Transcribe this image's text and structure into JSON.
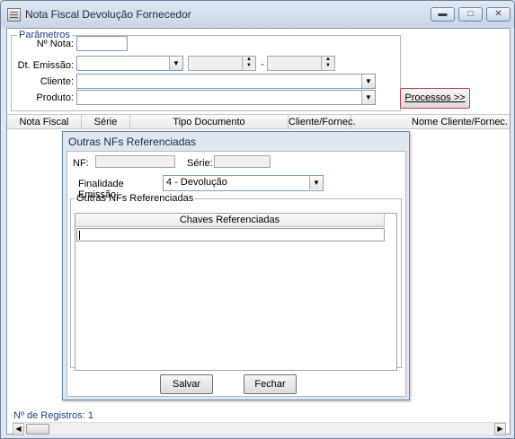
{
  "window": {
    "title": "Nota Fiscal Devolução Fornecedor",
    "minimize_icon": "minimize-icon",
    "maximize_icon": "maximize-icon",
    "close_icon": "close-icon"
  },
  "params": {
    "legend": "Parâmetros",
    "nota_label": "Nº Nota:",
    "nota_value": "",
    "emissao_label": "Dt. Emissão:",
    "emissao_value": "",
    "date_from": "",
    "date_separator": "-",
    "date_to": "",
    "cliente_label": "Cliente:",
    "cliente_value": "",
    "produto_label": "Produto:",
    "produto_value": ""
  },
  "processos_button": "Processos >>",
  "grid": {
    "columns": [
      "Nota Fiscal",
      "Série",
      "Tipo Documento",
      "Cliente/Fornec.",
      "Nome Cliente/Fornec."
    ]
  },
  "records_label": "Nº de Registros: 1",
  "dialog": {
    "title": "Outras NFs Referenciadas",
    "nf_label": "NF:",
    "nf_value": "",
    "serie_label": "Série:",
    "serie_value": "",
    "finalidade_label": "Finalidade Emissão:",
    "finalidade_value": "4 - Devolução",
    "group_legend": "Outras NFs Referenciadas",
    "refs_column": "Chaves Referenciadas",
    "save_button": "Salvar",
    "close_button": "Fechar"
  },
  "colors": {
    "accent_text": "#1a3d8a",
    "window_frame": "#dde6f1",
    "highlight_border": "#c84040"
  }
}
